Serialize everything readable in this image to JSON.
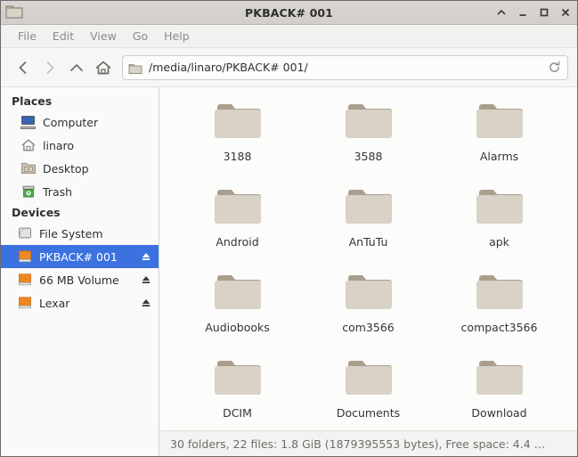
{
  "window": {
    "title": "PKBACK# 001",
    "icon": "folder-icon",
    "controls": {
      "shade": "shade-window-button",
      "minimize": "minimize-window-button",
      "maximize": "maximize-window-button",
      "close": "close-window-button"
    }
  },
  "menubar": {
    "items": [
      {
        "label": "File"
      },
      {
        "label": "Edit"
      },
      {
        "label": "View"
      },
      {
        "label": "Go"
      },
      {
        "label": "Help"
      }
    ]
  },
  "toolbar": {
    "back": "back-button",
    "forward": "forward-button",
    "up": "up-button",
    "home": "home-button",
    "path": "/media/linaro/PKBACK# 001/",
    "reload": "reload-button"
  },
  "sidebar": {
    "sections": [
      {
        "title": "Places",
        "items": [
          {
            "label": "Computer",
            "icon": "computer-icon",
            "selected": false,
            "eject": false
          },
          {
            "label": "linaro",
            "icon": "home-icon",
            "selected": false,
            "eject": false
          },
          {
            "label": "Desktop",
            "icon": "desktop-folder-icon",
            "selected": false,
            "eject": false
          },
          {
            "label": "Trash",
            "icon": "trash-icon",
            "selected": false,
            "eject": false
          }
        ]
      },
      {
        "title": "Devices",
        "items": [
          {
            "label": "File System",
            "icon": "harddisk-icon",
            "selected": false,
            "eject": false
          },
          {
            "label": "PKBACK# 001",
            "icon": "removable-drive-icon",
            "selected": true,
            "eject": true
          },
          {
            "label": "66 MB Volume",
            "icon": "removable-drive-icon",
            "selected": false,
            "eject": true
          },
          {
            "label": "Lexar",
            "icon": "removable-drive-icon",
            "selected": false,
            "eject": true
          }
        ]
      }
    ]
  },
  "content": {
    "items": [
      {
        "label": "3188",
        "icon": "folder-icon"
      },
      {
        "label": "3588",
        "icon": "folder-icon"
      },
      {
        "label": "Alarms",
        "icon": "folder-icon"
      },
      {
        "label": "Android",
        "icon": "folder-icon"
      },
      {
        "label": "AnTuTu",
        "icon": "folder-icon"
      },
      {
        "label": "apk",
        "icon": "folder-icon"
      },
      {
        "label": "Audiobooks",
        "icon": "folder-icon"
      },
      {
        "label": "com3566",
        "icon": "folder-icon"
      },
      {
        "label": "compact3566",
        "icon": "folder-icon"
      },
      {
        "label": "DCIM",
        "icon": "folder-icon"
      },
      {
        "label": "Documents",
        "icon": "folder-icon"
      },
      {
        "label": "Download",
        "icon": "folder-icon"
      }
    ]
  },
  "statusbar": {
    "text": "30 folders, 22 files: 1.8 GiB (1879395553 bytes), Free space: 4.4 …"
  },
  "colors": {
    "selection": "#3c72e0",
    "folder_body": "#d8d2c7",
    "folder_tab": "#a99d8c",
    "drive_orange": "#f0881f"
  }
}
